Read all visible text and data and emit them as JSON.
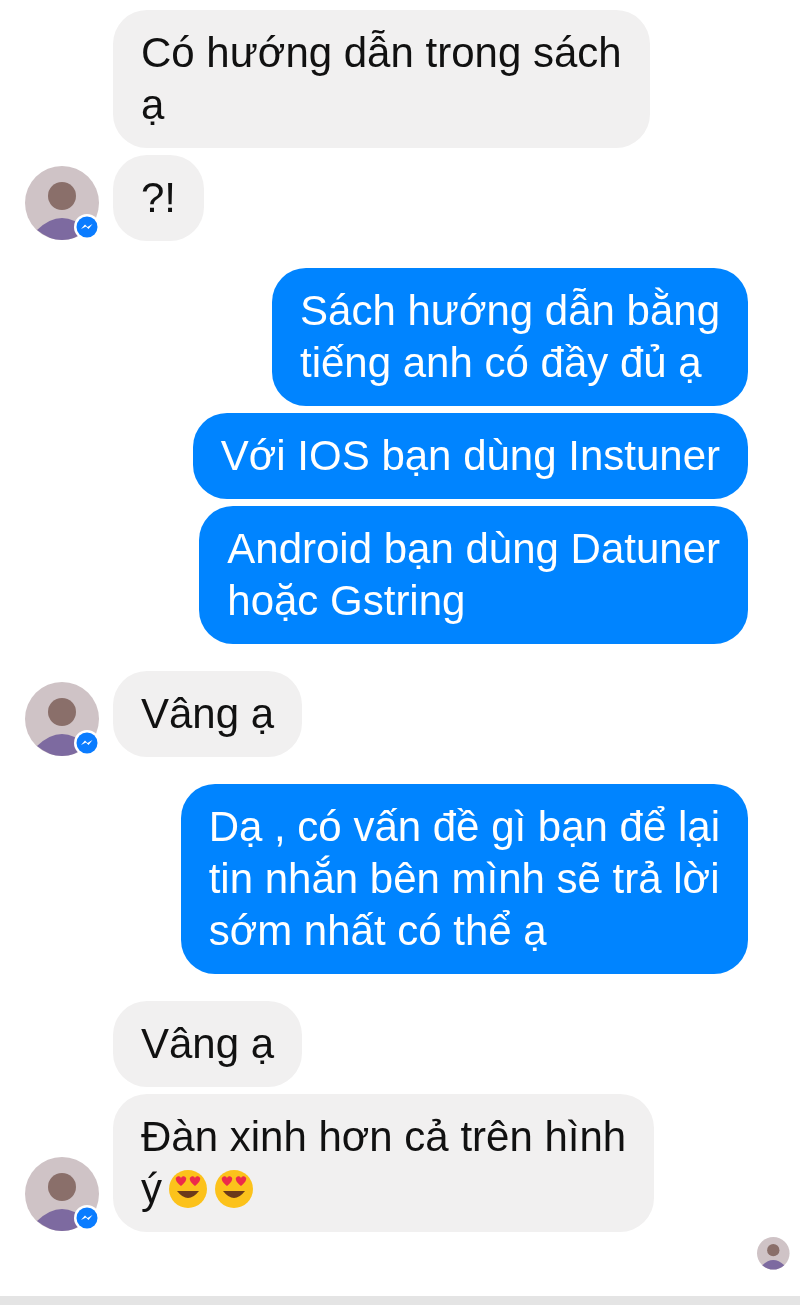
{
  "messages": [
    {
      "kind": "incoming",
      "show_avatar": false,
      "lines": [
        "Có hướng dẫn trong sách",
        "ạ"
      ]
    },
    {
      "kind": "incoming",
      "show_avatar": true,
      "lines": [
        "?!"
      ]
    },
    {
      "kind": "outgoing",
      "lines": [
        "Sách hướng dẫn bằng",
        "tiếng anh có đầy đủ ạ"
      ]
    },
    {
      "kind": "outgoing",
      "lines": [
        "Với IOS bạn dùng Instuner"
      ]
    },
    {
      "kind": "outgoing",
      "lines": [
        "Android bạn dùng Datuner",
        "hoặc Gstring"
      ]
    },
    {
      "kind": "incoming",
      "show_avatar": true,
      "lines": [
        "Vâng ạ"
      ]
    },
    {
      "kind": "outgoing",
      "lines": [
        "Dạ , có vấn đề gì bạn để lại",
        "tin nhắn bên mình sẽ trả lời",
        "sớm nhất có thể ạ"
      ]
    },
    {
      "kind": "incoming",
      "show_avatar": false,
      "lines": [
        "Vâng ạ"
      ]
    },
    {
      "kind": "incoming",
      "show_avatar": true,
      "lines": [
        "Đàn xinh hơn cả trên hình",
        "ý"
      ],
      "emoji": [
        {
          "kind": "heart-eyes"
        },
        {
          "kind": "heart-eyes"
        }
      ]
    }
  ],
  "seen_receipt": true
}
